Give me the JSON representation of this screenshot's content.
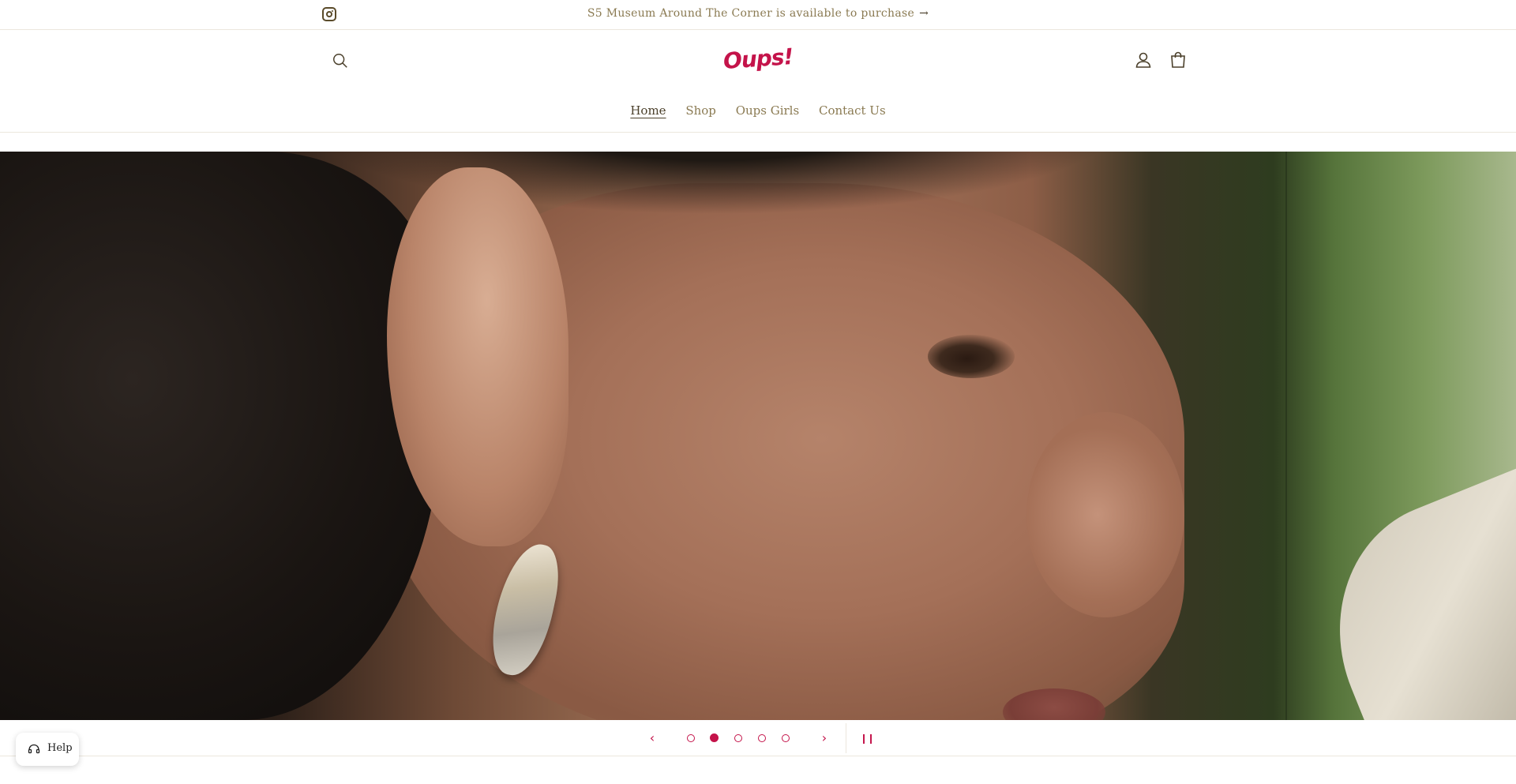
{
  "announcement": {
    "message": "S5 Museum Around The Corner is available to purchase",
    "arrow": "→",
    "social_icon": "instagram-icon"
  },
  "header": {
    "logo_text": "Oups!",
    "search_icon": "search-icon",
    "account_icon": "account-icon",
    "cart_icon": "cart-icon",
    "brand_color": "#c4134a"
  },
  "nav": {
    "items": [
      {
        "label": "Home",
        "active": true
      },
      {
        "label": "Shop",
        "active": false
      },
      {
        "label": "Oups Girls",
        "active": false
      },
      {
        "label": "Contact Us",
        "active": false
      }
    ]
  },
  "slider": {
    "prev": "‹",
    "next": "›",
    "pause": "❙❙",
    "slide_count": 5,
    "active_slide": 2
  },
  "help_widget": {
    "label": "Help",
    "icon": "chat-support-icon"
  }
}
